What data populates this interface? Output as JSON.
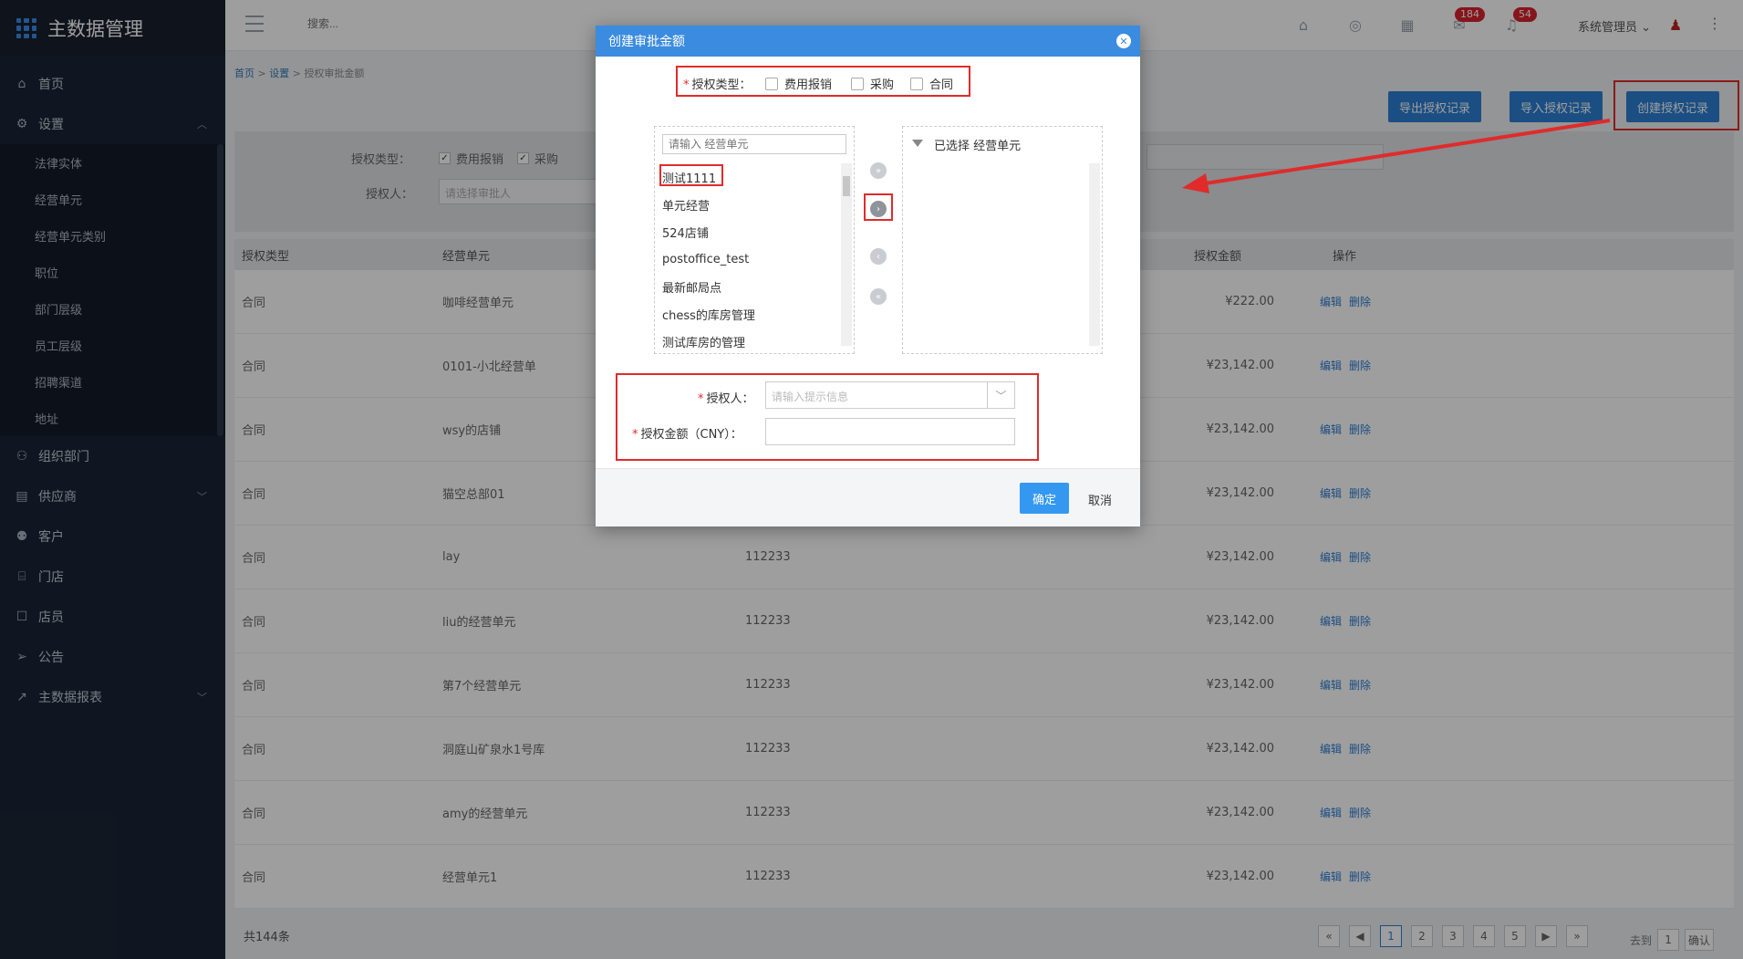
{
  "app": {
    "title": "主数据管理"
  },
  "sidebar": {
    "items": [
      {
        "label": "首页",
        "icon": "home-icon"
      },
      {
        "label": "设置",
        "icon": "gear-icon",
        "expanded": true
      },
      {
        "label": "组织部门",
        "icon": "org-icon"
      },
      {
        "label": "供应商",
        "icon": "supplier-icon"
      },
      {
        "label": "客户",
        "icon": "customer-icon"
      },
      {
        "label": "门店",
        "icon": "store-icon"
      },
      {
        "label": "店员",
        "icon": "clerk-icon"
      },
      {
        "label": "公告",
        "icon": "announce-icon"
      },
      {
        "label": "主数据报表",
        "icon": "chart-icon"
      }
    ],
    "settings_sub": [
      "法律实体",
      "经营单元",
      "经营单元类别",
      "职位",
      "部门层级",
      "员工层级",
      "招聘渠道",
      "地址"
    ]
  },
  "topbar": {
    "search_placeholder": "搜索...",
    "badge_messages": "184",
    "badge_alerts": "54",
    "user": "系统管理员"
  },
  "breadcrumb": {
    "home": "首页",
    "settings": "设置",
    "current": "授权审批金额"
  },
  "actions": {
    "export": "导出授权记录",
    "import": "导入授权记录",
    "create": "创建授权记录"
  },
  "filter": {
    "type_label": "授权类型：",
    "opt1": "费用报销",
    "opt2": "采购",
    "approver_label": "授权人：",
    "approver_placeholder": "请选择审批人"
  },
  "table": {
    "headers": {
      "type": "授权类型",
      "unit": "经营单元",
      "amount": "授权金额",
      "ops": "操作"
    },
    "edit": "编辑",
    "delete": "删除",
    "rows": [
      {
        "type": "合同",
        "unit": "咖啡经营单元",
        "code": "",
        "amount": "¥222.00"
      },
      {
        "type": "合同",
        "unit": "0101-小北经营单",
        "code": "",
        "amount": "¥23,142.00"
      },
      {
        "type": "合同",
        "unit": "wsy的店铺",
        "code": "",
        "amount": "¥23,142.00"
      },
      {
        "type": "合同",
        "unit": "猫空总部01",
        "code": "",
        "amount": "¥23,142.00"
      },
      {
        "type": "合同",
        "unit": "lay",
        "code": "112233",
        "amount": "¥23,142.00"
      },
      {
        "type": "合同",
        "unit": "liu的经营单元",
        "code": "112233",
        "amount": "¥23,142.00"
      },
      {
        "type": "合同",
        "unit": "第7个经营单元",
        "code": "112233",
        "amount": "¥23,142.00"
      },
      {
        "type": "合同",
        "unit": "洞庭山矿泉水1号库",
        "code": "112233",
        "amount": "¥23,142.00"
      },
      {
        "type": "合同",
        "unit": "amy的经营单元",
        "code": "112233",
        "amount": "¥23,142.00"
      },
      {
        "type": "合同",
        "unit": "经营单元1",
        "code": "112233",
        "amount": "¥23,142.00"
      }
    ]
  },
  "footer": {
    "total": "共144条",
    "pages": [
      "1",
      "2",
      "3",
      "4",
      "5"
    ],
    "prev_first": "«",
    "next_last": "»",
    "goto_label": "去到",
    "goto_value": "1",
    "goto_confirm": "确认"
  },
  "modal": {
    "title": "创建审批金额",
    "type_label": "授权类型：",
    "type_opts": [
      "费用报销",
      "采购",
      "合同"
    ],
    "search_placeholder": "请输入 经营单元",
    "units": [
      "测试1111",
      "单元经营",
      "524店铺",
      "postoffice_test",
      "最新邮局点",
      "chess的库房管理",
      "测试库房的管理"
    ],
    "selected_title": "已选择 经营单元",
    "approver_label": "授权人：",
    "approver_placeholder": "请输入提示信息",
    "amount_label": "授权金额（CNY）：",
    "ok": "确定",
    "cancel": "取消"
  },
  "colors": {
    "accent": "#2d7fd3",
    "highlight": "#e02b2b",
    "sidebar": "#1b2536"
  }
}
